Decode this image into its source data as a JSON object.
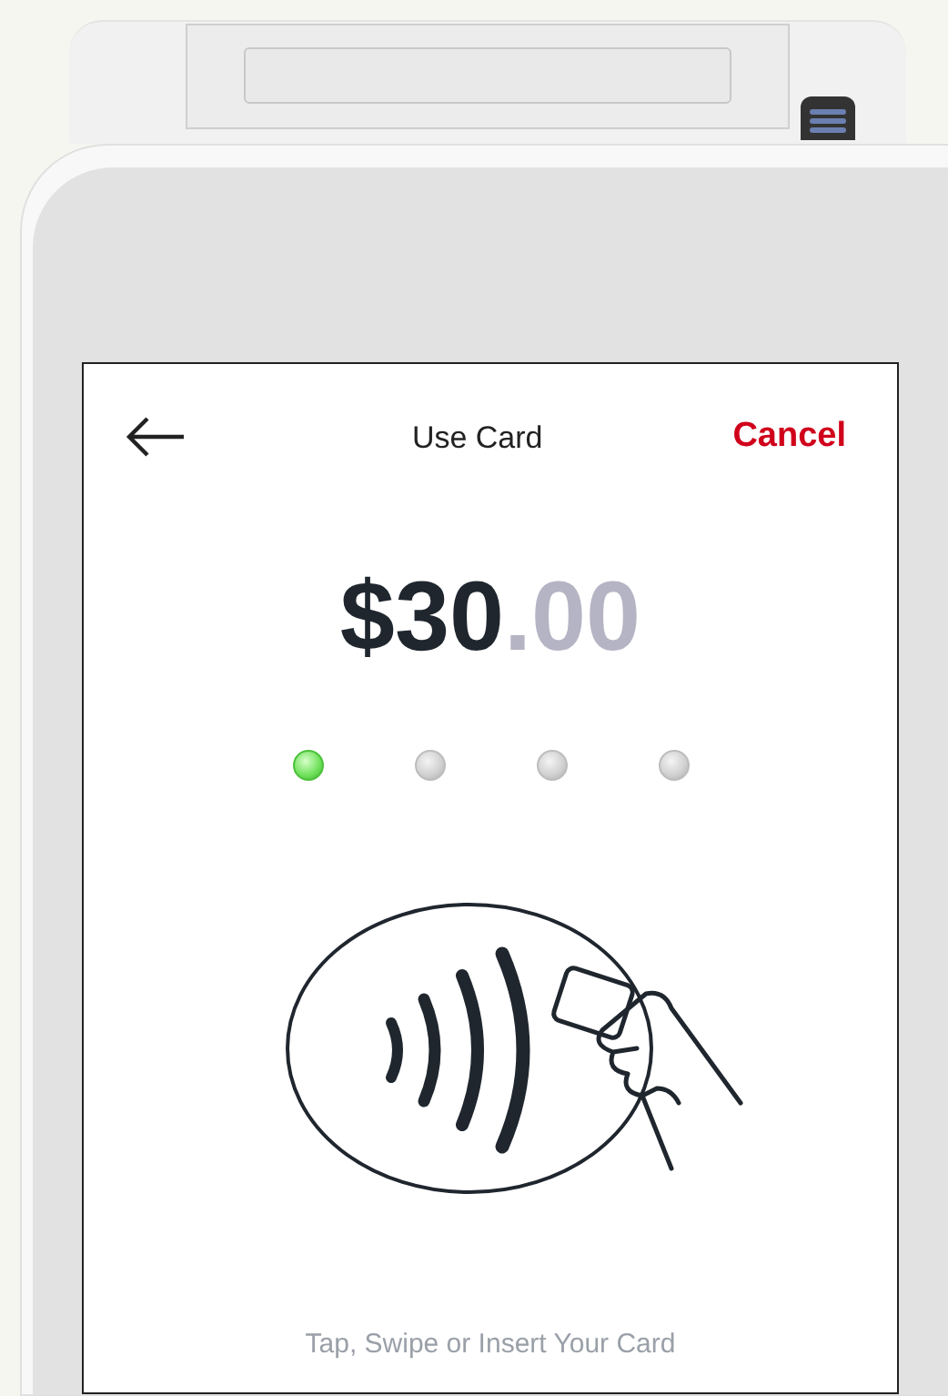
{
  "header": {
    "title": "Use Card",
    "cancel": "Cancel"
  },
  "amount": {
    "whole": "$30",
    "cents": ".00"
  },
  "progress_dots": [
    {
      "on": true
    },
    {
      "on": false
    },
    {
      "on": false
    },
    {
      "on": false
    }
  ],
  "instruction": "Tap, Swipe or Insert Your Card"
}
